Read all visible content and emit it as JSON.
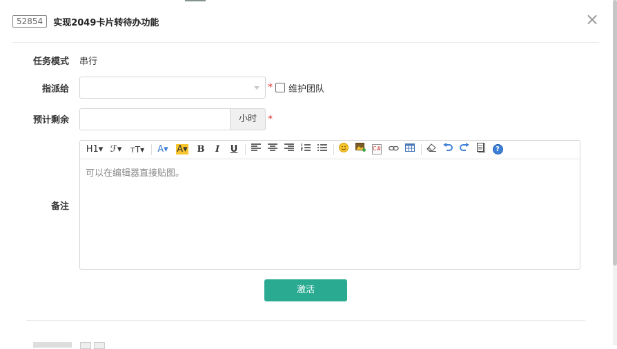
{
  "dialog": {
    "id": "52854",
    "title": "实现2049卡片转待办功能",
    "close_icon": "×"
  },
  "form": {
    "mode_label": "任务模式",
    "mode_value": "串行",
    "assign_label": "指派给",
    "assign_value": "",
    "required_mark": "*",
    "team_checkbox_label": "维护团队",
    "team_checked": false,
    "remaining_label": "预计剩余",
    "remaining_value": "",
    "remaining_unit": "小时",
    "note_label": "备注",
    "note_placeholder": "可以在编辑器直接贴图。"
  },
  "toolbar": {
    "heading": "H1▾",
    "font": "ℱ▾",
    "font_size": "ᴛT▾",
    "font_color": "A▾",
    "bg_color": "A▾",
    "bold": "B",
    "italic": "I",
    "underline": "U",
    "emoticon": "☺",
    "code": "C#",
    "help": "?"
  },
  "submit_label": "激活",
  "colors": {
    "accent": "#2aab91",
    "required": "#e23030",
    "highlight": "#f7c52d",
    "icon_blue": "#3d7fd5"
  }
}
